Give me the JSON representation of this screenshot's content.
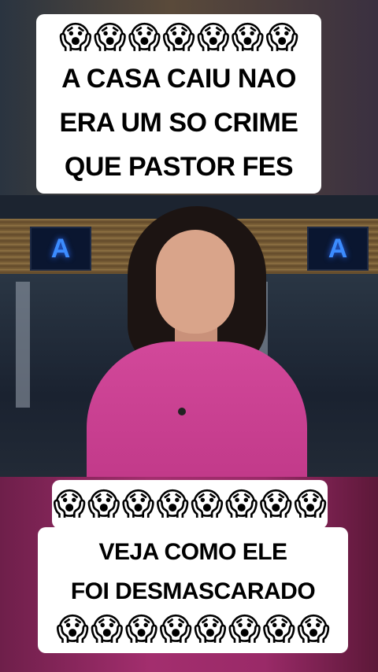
{
  "top_caption": {
    "emoji": "😱",
    "emoji_count": 7,
    "lines": [
      "A CASA CAIU  NAO",
      "ERA UM SO CRIME",
      "QUE PASTOR FES"
    ]
  },
  "video": {
    "monitor_logo": "A"
  },
  "bottom_caption": {
    "emoji": "😱",
    "emoji_row_top_count": 8,
    "lines": [
      "VEJA COMO ELE",
      "FOI DESMASCARADO"
    ],
    "emoji_row_bottom_count": 8
  },
  "colors": {
    "caption_bg": "#ffffff",
    "caption_text": "#000000",
    "bottom_bg": "#a32e6e",
    "blouse": "#c23a8a"
  }
}
